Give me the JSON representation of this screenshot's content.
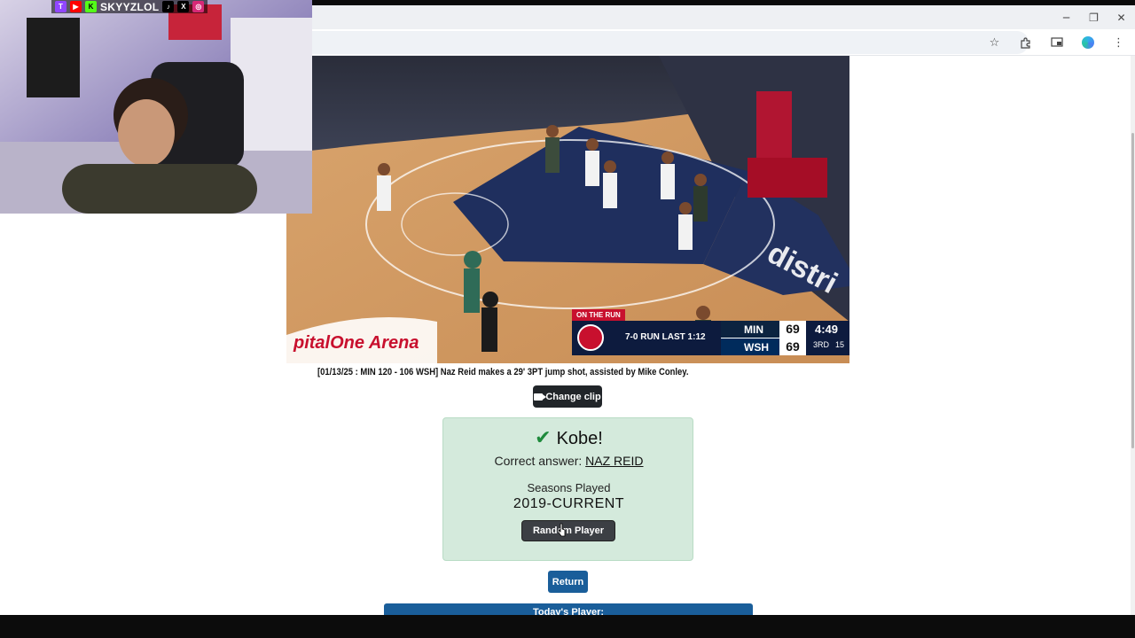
{
  "window": {
    "minimize_glyph": "─",
    "restore_glyph": "❐",
    "close_glyph": "✕"
  },
  "toolbar": {
    "icons": [
      "star-icon",
      "extensions-icon",
      "cast-icon",
      "profile-icon",
      "more-icon"
    ]
  },
  "webcam": {
    "handle": "SKYYZLOL",
    "social": [
      "twitch",
      "youtube",
      "kick",
      "tiktok",
      "x",
      "instagram"
    ]
  },
  "video": {
    "banner": "ON THE RUN",
    "run_text": "7-0 RUN LAST 1:12",
    "teams": [
      {
        "abbr": "MIN",
        "score": "69"
      },
      {
        "abbr": "WSH",
        "score": "69"
      }
    ],
    "clock": "4:49",
    "period": "3RD",
    "shot_clock": "15",
    "arena_text": "pitalOne Arena"
  },
  "clip": {
    "caption": "[01/13/25 : MIN 120 - 106 WSH] Naz Reid makes a 29' 3PT jump shot, assisted by Mike Conley.",
    "change_label": "Change clip"
  },
  "result": {
    "title": "Kobe!",
    "correct_prefix": "Correct answer:",
    "answer": "NAZ REID",
    "seasons_label": "Seasons Played",
    "seasons_value": "2019-CURRENT",
    "random_label": "Random Player"
  },
  "footer": {
    "return_label": "Return",
    "today_label": "Today's Player:"
  },
  "colors": {
    "result_bg": "#d4eadc",
    "primary_blue": "#1a5e9a",
    "dark_button": "#212529",
    "check_green": "#1e8a3c"
  }
}
